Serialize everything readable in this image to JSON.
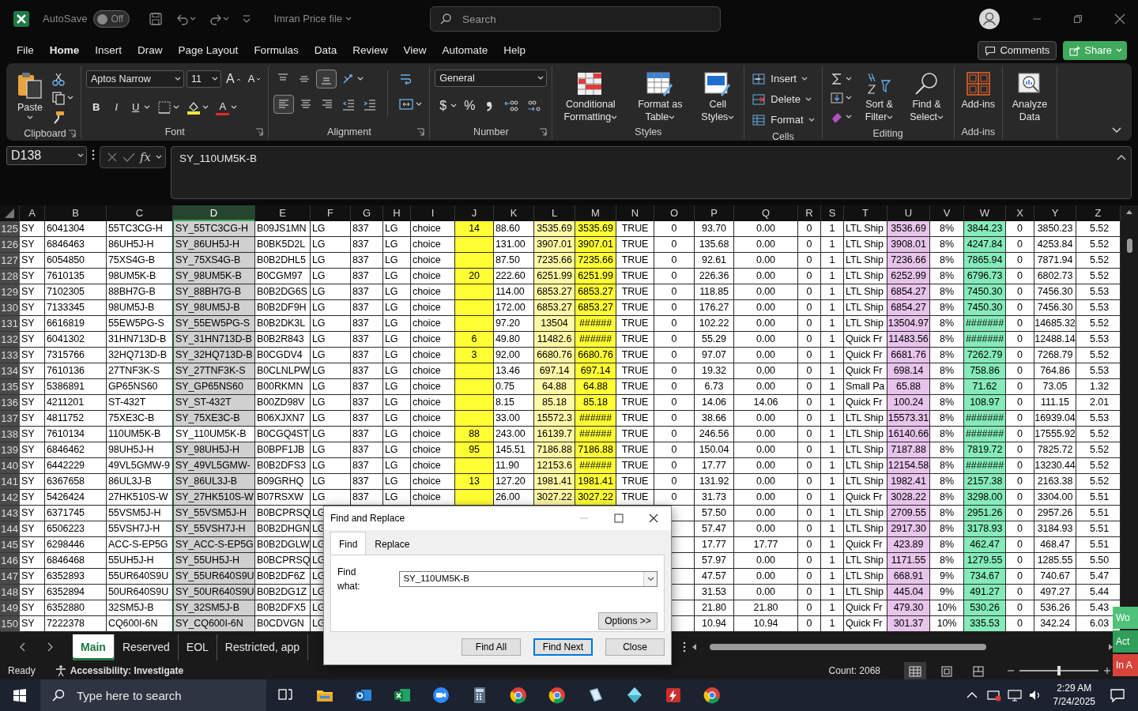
{
  "title_bar": {
    "autosave_label": "AutoSave",
    "autosave_state": "Off",
    "autosave_on": false,
    "file_name": "Imran Price file",
    "search_placeholder": "Search"
  },
  "menu": [
    {
      "label": "File",
      "selected": false
    },
    {
      "label": "Home",
      "selected": true
    },
    {
      "label": "Insert",
      "selected": false
    },
    {
      "label": "Draw",
      "selected": false
    },
    {
      "label": "Page Layout",
      "selected": false
    },
    {
      "label": "Formulas",
      "selected": false
    },
    {
      "label": "Data",
      "selected": false
    },
    {
      "label": "Review",
      "selected": false
    },
    {
      "label": "View",
      "selected": false
    },
    {
      "label": "Automate",
      "selected": false
    },
    {
      "label": "Help",
      "selected": false
    }
  ],
  "comments_button": "Comments",
  "share_button": "Share",
  "ribbon": {
    "clipboard": {
      "paste": "Paste",
      "label": "Clipboard"
    },
    "font": {
      "name": "Aptos Narrow",
      "size": "11",
      "grow": "A",
      "shrink": "A",
      "bold": "B",
      "italic": "I",
      "underline": "U",
      "font_color": "A",
      "label": "Font"
    },
    "alignment": {
      "vertical": [
        {
          "selected": false
        },
        {
          "selected": false
        },
        {
          "selected": true
        }
      ],
      "horizontal": [
        {
          "selected": true
        },
        {
          "selected": false
        },
        {
          "selected": false
        }
      ],
      "label": "Alignment"
    },
    "number": {
      "format": "General",
      "currency": "$",
      "percent": "%",
      "label": "Number"
    },
    "styles": {
      "buttons": [
        "Conditional Formatting",
        "Format as Table",
        "Cell Styles"
      ],
      "label": "Styles"
    },
    "cells": {
      "buttons": [
        "Insert",
        "Delete",
        "Format"
      ],
      "label": "Cells"
    },
    "editing": {
      "buttons": [
        "Sort & Filter",
        "Find & Select"
      ],
      "label": "Editing"
    },
    "add_ins": {
      "button": "Add-ins",
      "label": "Add-ins"
    },
    "analyze": {
      "button": "Analyze Data"
    }
  },
  "formula_bar": {
    "name_box": "D138",
    "fx": "fx",
    "formula": "SY_110UM5K-B"
  },
  "table": {
    "columns": [
      {
        "label": "A",
        "selected": false
      },
      {
        "label": "B",
        "selected": false
      },
      {
        "label": "C",
        "selected": false
      },
      {
        "label": "D",
        "selected": true
      },
      {
        "label": "E",
        "selected": false
      },
      {
        "label": "F",
        "selected": false
      },
      {
        "label": "G",
        "selected": false
      },
      {
        "label": "H",
        "selected": false
      },
      {
        "label": "I",
        "selected": false
      },
      {
        "label": "J",
        "selected": false,
        "color": "#ffff33"
      },
      {
        "label": "K",
        "selected": false
      },
      {
        "label": "L",
        "selected": false,
        "color": "#fff9a6"
      },
      {
        "label": "M",
        "selected": false,
        "color": "#ffff33"
      },
      {
        "label": "N",
        "selected": false
      },
      {
        "label": "O",
        "selected": false
      },
      {
        "label": "P",
        "selected": false
      },
      {
        "label": "Q",
        "selected": false
      },
      {
        "label": "R",
        "selected": false
      },
      {
        "label": "S",
        "selected": false
      },
      {
        "label": "T",
        "selected": false
      },
      {
        "label": "U",
        "selected": false,
        "color": "#e8c4ec"
      },
      {
        "label": "V",
        "selected": false
      },
      {
        "label": "W",
        "selected": false,
        "color": "#86ebbb"
      },
      {
        "label": "X",
        "selected": false
      },
      {
        "label": "Y",
        "selected": false
      },
      {
        "label": "Z",
        "selected": false
      }
    ],
    "rows": [
      {
        "number": "125",
        "active": false,
        "cells": [
          "SY",
          "6041304",
          "55TC3CG-H",
          "SY_55TC3CG-H",
          "B09JS1MN",
          "LG",
          "837",
          "LG",
          "choice",
          "14",
          "88.60",
          "3535.69",
          "3535.69",
          "TRUE",
          "0",
          "93.70",
          "0.00",
          "0",
          "1",
          "LTL Ship",
          "3536.69",
          "8%",
          "3844.23",
          "0",
          "3850.23",
          "5.52"
        ]
      },
      {
        "number": "126",
        "active": false,
        "cells": [
          "SY",
          "6846463",
          "86UH5J-H",
          "SY_86UH5J-H",
          "B0BK5D2L",
          "LG",
          "837",
          "LG",
          "choice",
          "",
          "131.00",
          "3907.01",
          "3907.01",
          "TRUE",
          "0",
          "135.68",
          "0.00",
          "0",
          "1",
          "LTL Ship",
          "3908.01",
          "8%",
          "4247.84",
          "0",
          "4253.84",
          "5.52"
        ]
      },
      {
        "number": "127",
        "active": false,
        "cells": [
          "SY",
          "6054850",
          "75XS4G-B",
          "SY_75XS4G-B",
          "B0B2DHL5",
          "LG",
          "837",
          "LG",
          "choice",
          "",
          "87.50",
          "7235.66",
          "7235.66",
          "TRUE",
          "0",
          "92.61",
          "0.00",
          "0",
          "1",
          "LTL Ship",
          "7236.66",
          "8%",
          "7865.94",
          "0",
          "7871.94",
          "5.52"
        ]
      },
      {
        "number": "128",
        "active": false,
        "cells": [
          "SY",
          "7610135",
          "98UM5K-B",
          "SY_98UM5K-B",
          "B0CGM97",
          "LG",
          "837",
          "LG",
          "choice",
          "20",
          "222.60",
          "6251.99",
          "6251.99",
          "TRUE",
          "0",
          "226.36",
          "0.00",
          "0",
          "1",
          "LTL Ship",
          "6252.99",
          "8%",
          "6796.73",
          "0",
          "6802.73",
          "5.52"
        ]
      },
      {
        "number": "129",
        "active": false,
        "cells": [
          "SY",
          "7102305",
          "88BH7G-B",
          "SY_88BH7G-B",
          "B0B2DG6S",
          "LG",
          "837",
          "LG",
          "choice",
          "",
          "114.00",
          "6853.27",
          "6853.27",
          "TRUE",
          "0",
          "118.85",
          "0.00",
          "0",
          "1",
          "LTL Ship",
          "6854.27",
          "8%",
          "7450.30",
          "0",
          "7456.30",
          "5.53"
        ]
      },
      {
        "number": "130",
        "active": false,
        "cells": [
          "SY",
          "7133345",
          "98UM5J-B",
          "SY_98UM5J-B",
          "B0B2DF9H",
          "LG",
          "837",
          "LG",
          "choice",
          "",
          "172.00",
          "6853.27",
          "6853.27",
          "TRUE",
          "0",
          "176.27",
          "0.00",
          "0",
          "1",
          "LTL Ship",
          "6854.27",
          "8%",
          "7450.30",
          "0",
          "7456.30",
          "5.53"
        ]
      },
      {
        "number": "131",
        "active": false,
        "cells": [
          "SY",
          "6616819",
          "55EW5PG-S",
          "SY_55EW5PG-S",
          "B0B2DK3L",
          "LG",
          "837",
          "LG",
          "choice",
          "",
          "97.20",
          "13504",
          "######",
          "TRUE",
          "0",
          "102.22",
          "0.00",
          "0",
          "1",
          "LTL Ship",
          "13504.97",
          "8%",
          "#######",
          "0",
          "14685.32",
          "5.52"
        ]
      },
      {
        "number": "132",
        "active": false,
        "cells": [
          "SY",
          "6041302",
          "31HN713D-B",
          "SY_31HN713D-B",
          "B0B2R843",
          "LG",
          "837",
          "LG",
          "choice",
          "6",
          "49.80",
          "11482.6",
          "######",
          "TRUE",
          "0",
          "55.29",
          "0.00",
          "0",
          "1",
          "Quick Fr",
          "11483.56",
          "8%",
          "#######",
          "0",
          "12488.14",
          "5.53"
        ]
      },
      {
        "number": "133",
        "active": false,
        "cells": [
          "SY",
          "7315766",
          "32HQ713D-B",
          "SY_32HQ713D-B",
          "B0CGDV4",
          "LG",
          "837",
          "LG",
          "choice",
          "3",
          "92.00",
          "6680.76",
          "6680.76",
          "TRUE",
          "0",
          "97.07",
          "0.00",
          "0",
          "1",
          "Quick Fr",
          "6681.76",
          "8%",
          "7262.79",
          "0",
          "7268.79",
          "5.52"
        ]
      },
      {
        "number": "134",
        "active": false,
        "cells": [
          "SY",
          "7610136",
          "27TNF3K-S",
          "SY_27TNF3K-S",
          "B0CLNLPW",
          "LG",
          "837",
          "LG",
          "choice",
          "",
          "13.46",
          "697.14",
          "697.14",
          "TRUE",
          "0",
          "19.32",
          "0.00",
          "0",
          "1",
          "Quick Fr",
          "698.14",
          "8%",
          "758.86",
          "0",
          "764.86",
          "5.53"
        ]
      },
      {
        "number": "135",
        "active": false,
        "cells": [
          "SY",
          "5386891",
          "GP65NS60",
          "SY_GP65NS60",
          "B00RKMN",
          "LG",
          "837",
          "LG",
          "choice",
          "",
          "0.75",
          "64.88",
          "64.88",
          "TRUE",
          "0",
          "6.73",
          "0.00",
          "0",
          "1",
          "Small Pa",
          "65.88",
          "8%",
          "71.62",
          "0",
          "73.05",
          "1.32"
        ]
      },
      {
        "number": "136",
        "active": false,
        "cells": [
          "SY",
          "4211201",
          "ST-432T",
          "SY_ST-432T",
          "B00ZD98V",
          "LG",
          "837",
          "LG",
          "choice",
          "",
          "8.15",
          "85.18",
          "85.18",
          "TRUE",
          "0",
          "14.06",
          "14.06",
          "0",
          "1",
          "Quick Fr",
          "100.24",
          "8%",
          "108.97",
          "0",
          "111.15",
          "2.01"
        ]
      },
      {
        "number": "137",
        "active": false,
        "cells": [
          "SY",
          "4811752",
          "75XE3C-B",
          "SY_75XE3C-B",
          "B06XJXN7",
          "LG",
          "837",
          "LG",
          "choice",
          "",
          "33.00",
          "15572.3",
          "######",
          "TRUE",
          "0",
          "38.66",
          "0.00",
          "0",
          "1",
          "LTL Ship",
          "15573.31",
          "8%",
          "#######",
          "0",
          "16939.04",
          "5.53"
        ]
      },
      {
        "number": "138",
        "active": true,
        "cells": [
          "SY",
          "7610134",
          "110UM5K-B",
          "SY_110UM5K-B",
          "B0CGQ4ST",
          "LG",
          "837",
          "LG",
          "choice",
          "88",
          "243.00",
          "16139.7",
          "######",
          "TRUE",
          "0",
          "246.56",
          "0.00",
          "0",
          "1",
          "LTL Ship",
          "16140.66",
          "8%",
          "#######",
          "0",
          "17555.92",
          "5.52"
        ]
      },
      {
        "number": "139",
        "active": false,
        "cells": [
          "SY",
          "6846462",
          "98UH5J-H",
          "SY_98UH5J-H",
          "B0BPF1JB",
          "LG",
          "837",
          "LG",
          "choice",
          "95",
          "145.51",
          "7186.88",
          "7186.88",
          "TRUE",
          "0",
          "150.04",
          "0.00",
          "0",
          "1",
          "LTL Ship",
          "7187.88",
          "8%",
          "7819.72",
          "0",
          "7825.72",
          "5.52"
        ]
      },
      {
        "number": "140",
        "active": false,
        "cells": [
          "SY",
          "6442229",
          "49VL5GMW-9",
          "SY_49VL5GMW-",
          "B0B2DFS3",
          "LG",
          "837",
          "LG",
          "choice",
          "",
          "11.90",
          "12153.6",
          "######",
          "TRUE",
          "0",
          "17.77",
          "0.00",
          "0",
          "1",
          "LTL Ship",
          "12154.58",
          "8%",
          "#######",
          "0",
          "13230.44",
          "5.52"
        ]
      },
      {
        "number": "141",
        "active": false,
        "cells": [
          "SY",
          "6367658",
          "86UL3J-B",
          "SY_86UL3J-B",
          "B09GRHQ",
          "LG",
          "837",
          "LG",
          "choice",
          "13",
          "127.20",
          "1981.41",
          "1981.41",
          "TRUE",
          "0",
          "131.92",
          "0.00",
          "0",
          "1",
          "LTL Ship",
          "1982.41",
          "8%",
          "2157.38",
          "0",
          "2163.38",
          "5.52"
        ]
      },
      {
        "number": "142",
        "active": false,
        "cells": [
          "SY",
          "5426424",
          "27HK510S-W",
          "SY_27HK510S-W",
          "B07RSXW",
          "LG",
          "837",
          "LG",
          "choice",
          "",
          "26.00",
          "3027.22",
          "3027.22",
          "TRUE",
          "0",
          "31.73",
          "0.00",
          "0",
          "1",
          "Quick Fr",
          "3028.22",
          "8%",
          "3298.00",
          "0",
          "3304.00",
          "5.51"
        ]
      },
      {
        "number": "143",
        "active": false,
        "cells": [
          "SY",
          "6371745",
          "55VSM5J-H",
          "SY_55VSM5J-H",
          "B0BCPRSQ",
          "LG",
          null,
          null,
          null,
          null,
          null,
          null,
          null,
          null,
          null,
          "57.50",
          "0.00",
          "0",
          "1",
          "LTL Ship",
          "2709.55",
          "8%",
          "2951.26",
          "0",
          "2957.26",
          "5.51"
        ]
      },
      {
        "number": "144",
        "active": false,
        "cells": [
          "SY",
          "6506223",
          "55VSH7J-H",
          "SY_55VSH7J-H",
          "B0B2DHGN",
          "LG",
          null,
          null,
          null,
          null,
          null,
          null,
          null,
          null,
          null,
          "57.47",
          "0.00",
          "0",
          "1",
          "LTL Ship",
          "2917.30",
          "8%",
          "3178.93",
          "0",
          "3184.93",
          "5.51"
        ]
      },
      {
        "number": "145",
        "active": false,
        "cells": [
          "SY",
          "6298446",
          "ACC-S-EP5G",
          "SY_ACC-S-EP5G",
          "B0B2DGLW",
          "LG",
          null,
          null,
          null,
          null,
          null,
          null,
          null,
          null,
          null,
          "17.77",
          "17.77",
          "0",
          "1",
          "Quick Fr",
          "423.89",
          "8%",
          "462.47",
          "0",
          "468.47",
          "5.51"
        ]
      },
      {
        "number": "146",
        "active": false,
        "cells": [
          "SY",
          "6846468",
          "55UH5J-H",
          "SY_55UH5J-H",
          "B0BCPRSQ",
          "LG",
          null,
          null,
          null,
          null,
          null,
          null,
          null,
          null,
          null,
          "57.97",
          "0.00",
          "0",
          "1",
          "LTL Ship",
          "1171.55",
          "8%",
          "1279.55",
          "0",
          "1285.55",
          "5.50"
        ]
      },
      {
        "number": "147",
        "active": false,
        "cells": [
          "SY",
          "6352893",
          "55UR640S9U",
          "SY_55UR640S9U",
          "B0B2DF6Z",
          "LG",
          null,
          null,
          null,
          null,
          null,
          null,
          null,
          null,
          null,
          "47.57",
          "0.00",
          "0",
          "1",
          "LTL Ship",
          "668.91",
          "9%",
          "734.67",
          "0",
          "740.67",
          "5.47"
        ]
      },
      {
        "number": "148",
        "active": false,
        "cells": [
          "SY",
          "6352894",
          "50UR640S9U",
          "SY_50UR640S9U",
          "B0B2DG1Z",
          "LG",
          null,
          null,
          null,
          null,
          null,
          null,
          null,
          null,
          null,
          "31.53",
          "0.00",
          "0",
          "1",
          "LTL Ship",
          "445.04",
          "9%",
          "491.27",
          "0",
          "497.27",
          "5.44"
        ]
      },
      {
        "number": "149",
        "active": false,
        "cells": [
          "SY",
          "6352880",
          "32SM5J-B",
          "SY_32SM5J-B",
          "B0B2DFX5",
          "LG",
          null,
          null,
          null,
          null,
          null,
          null,
          null,
          null,
          null,
          "21.80",
          "21.80",
          "0",
          "1",
          "Quick Fr",
          "479.30",
          "10%",
          "530.26",
          "0",
          "536.26",
          "5.43"
        ]
      },
      {
        "number": "150",
        "active": false,
        "cells": [
          "SY",
          "7222378",
          "CQ600I-6N",
          "SY_CQ600I-6N",
          "B0CDVGN",
          "LG",
          null,
          null,
          null,
          null,
          null,
          null,
          null,
          null,
          null,
          "10.94",
          "10.94",
          "0",
          "1",
          "Quick Fr",
          "301.37",
          "10%",
          "335.53",
          "0",
          "342.24",
          "6.03"
        ]
      }
    ]
  },
  "sheet_tabs": [
    {
      "label": "Main",
      "selected": true
    },
    {
      "label": "Reserved",
      "selected": false
    },
    {
      "label": "EOL",
      "selected": false
    },
    {
      "label": "Restricted, app",
      "selected": false
    }
  ],
  "dialog": {
    "title": "Find and Replace",
    "tabs": [
      {
        "label": "Find",
        "selected": true
      },
      {
        "label": "Replace",
        "selected": false
      }
    ],
    "find_label": "Find what:",
    "find_value": "SY_110UM5K-B",
    "options_button": "Options >>",
    "buttons": [
      {
        "label": "Find All",
        "default": false
      },
      {
        "label": "Find Next",
        "default": true
      },
      {
        "label": "Close",
        "default": false
      }
    ]
  },
  "status_bar": {
    "ready": "Ready",
    "accessibility": "Accessibility: Investigate",
    "count": "Count: 2068",
    "views": [
      {
        "selected": true
      },
      {
        "selected": false
      },
      {
        "selected": false
      }
    ],
    "zoom": {
      "level": 0.5
    }
  },
  "side_badges": [
    {
      "label": "Wo",
      "color": "#4fc27a"
    },
    {
      "label": "Act",
      "color": "#2f9e5b"
    },
    {
      "label": "In A",
      "color": "#d9443a"
    }
  ],
  "taskbar": {
    "search_placeholder": "Type here to search",
    "time": "2:29 AM",
    "date": "7/24/2025"
  }
}
